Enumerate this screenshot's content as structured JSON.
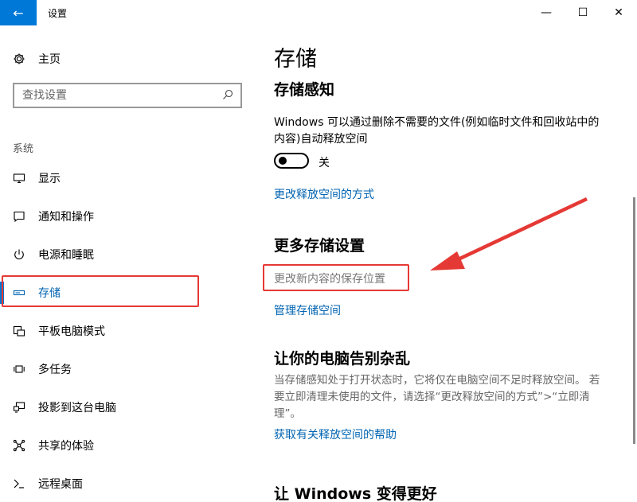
{
  "window": {
    "title": "设置",
    "back_glyph": "←",
    "minimize_glyph": "—",
    "maximize_glyph": "☐",
    "close_glyph": "✕"
  },
  "sidebar": {
    "home_label": "主页",
    "search_placeholder": "查找设置",
    "section_label": "系统",
    "items": [
      {
        "label": "显示",
        "icon": "display-icon"
      },
      {
        "label": "通知和操作",
        "icon": "notification-icon"
      },
      {
        "label": "电源和睡眠",
        "icon": "power-icon"
      },
      {
        "label": "存储",
        "icon": "storage-icon",
        "active": true
      },
      {
        "label": "平板电脑模式",
        "icon": "tablet-mode-icon"
      },
      {
        "label": "多任务",
        "icon": "multitasking-icon"
      },
      {
        "label": "投影到这台电脑",
        "icon": "project-icon"
      },
      {
        "label": "共享的体验",
        "icon": "share-icon"
      },
      {
        "label": "远程桌面",
        "icon": "remote-desktop-icon"
      }
    ]
  },
  "content": {
    "page_title": "存储",
    "storage_sense": {
      "title": "存储感知",
      "description": "Windows 可以通过删除不需要的文件(例如临时文件和回收站中的内容)自动释放空间",
      "toggle_state": "关",
      "toggle_on": false,
      "link": "更改释放空间的方式"
    },
    "more_settings": {
      "title": "更多存储设置",
      "change_save_location": "更改新内容的保存位置",
      "manage_storage": "管理存储空间"
    },
    "declutter": {
      "title": "让你的电脑告别杂乱",
      "description": "当存储感知处于打开状态时，它将仅在电脑空间不足时释放空间。 若要立即清理未使用的文件，请选择“更改释放空间的方式”>“立即清理”。",
      "help_link": "获取有关释放空间的帮助"
    },
    "better": {
      "title": "让 Windows 变得更好"
    }
  },
  "colors": {
    "accent": "#0078d7",
    "link": "#0063b1",
    "highlight": "#e53935"
  }
}
